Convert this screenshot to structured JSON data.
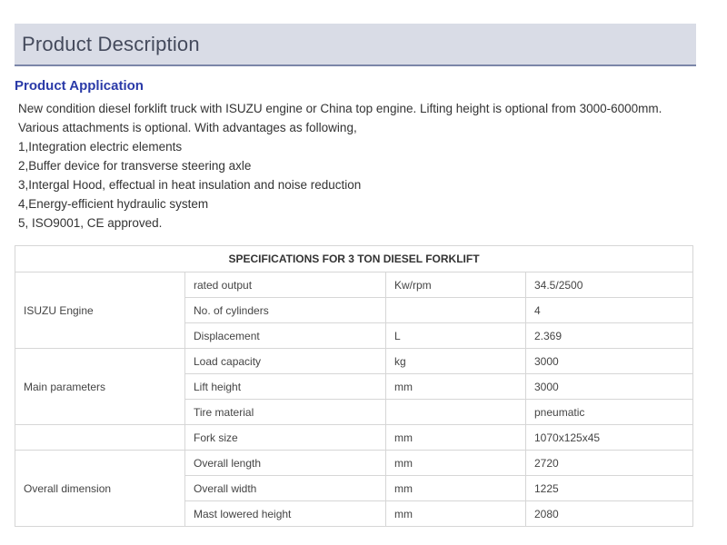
{
  "header": {
    "title": "Product Description"
  },
  "application": {
    "title": "Product Application",
    "lines": [
      "New condition diesel forklift truck with ISUZU engine or China top engine. Lifting height is optional from 3000-6000mm.",
      "Various attachments is optional. With advantages as following,",
      "1,Integration electric elements",
      "2,Buffer device for transverse steering axle",
      "3,Intergal Hood, effectual in heat insulation and noise reduction",
      "4,Energy-efficient hydraulic system",
      "5, ISO9001, CE approved."
    ]
  },
  "spec_table": {
    "title": "SPECIFICATIONS FOR 3 TON DIESEL FORKLIFT",
    "groups": {
      "engine": "ISUZU Engine",
      "main": "Main parameters",
      "overall": "Overall dimension"
    },
    "rows": [
      {
        "name": "rated output",
        "unit": "Kw/rpm",
        "value": "34.5/2500"
      },
      {
        "name": "No. of cylinders",
        "unit": "",
        "value": "4"
      },
      {
        "name": "Displacement",
        "unit": "L",
        "value": "2.369"
      },
      {
        "name": "Load capacity",
        "unit": "kg",
        "value": "3000"
      },
      {
        "name": "Lift height",
        "unit": "mm",
        "value": "3000"
      },
      {
        "name": "Tire material",
        "unit": "",
        "value": "pneumatic"
      },
      {
        "name": "Fork size",
        "unit": "mm",
        "value": "1070x125x45"
      },
      {
        "name": "Overall length",
        "unit": "mm",
        "value": "2720"
      },
      {
        "name": "Overall width",
        "unit": "mm",
        "value": "1225"
      },
      {
        "name": "Mast lowered height",
        "unit": "mm",
        "value": "2080"
      }
    ]
  }
}
